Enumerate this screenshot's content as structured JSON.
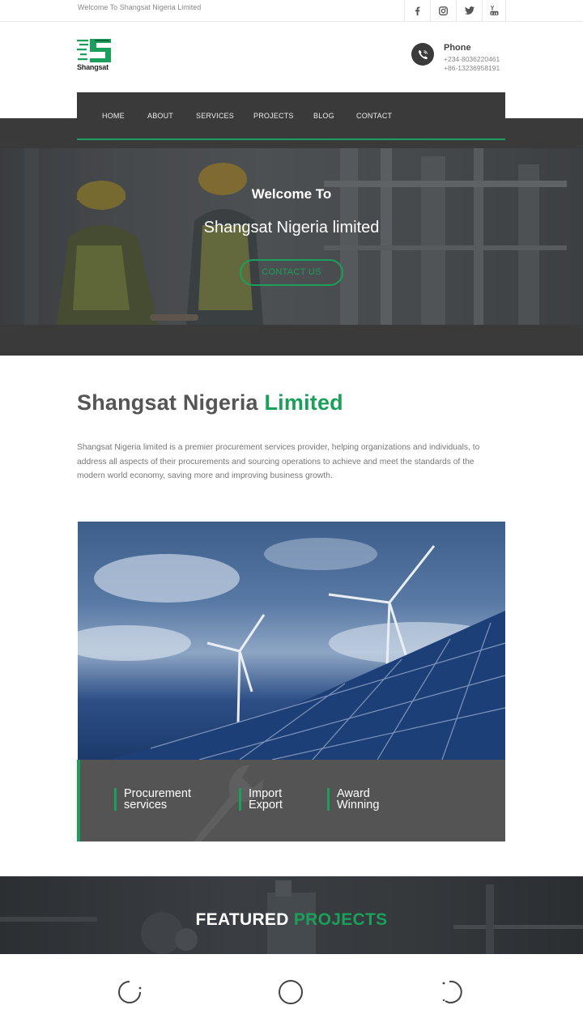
{
  "topbar": {
    "welcome": "Welcome To Shangsat Nigeria Limited",
    "socials": [
      "facebook-icon",
      "instagram-icon",
      "twitter-icon",
      "youtube-icon"
    ]
  },
  "brand": {
    "logo_text": "Shangsat",
    "accent": "#1aa05a"
  },
  "contact": {
    "label": "Phone",
    "numbers": [
      "+234-8036220461",
      "+86-13236958191"
    ]
  },
  "nav": {
    "items": [
      "HOME",
      "ABOUT",
      "SERVICES",
      "PROJECTS",
      "BLOG",
      "CONTACT"
    ]
  },
  "hero": {
    "welcome": "Welcome To",
    "title": "Shangsat Nigeria limited",
    "button": "CONTACT US"
  },
  "about": {
    "title_main": "Shangsat Nigeria",
    "title_accent": "Limited",
    "text": "Shangsat Nigeria limited is a premier procurement services provider, helping organizations and individuals, to address all aspects of their procurements and sourcing operations to achieve and meet the standards of the modern world economy, saving more and improving business growth."
  },
  "stats": [
    {
      "line1": "Procurement",
      "line2": "services"
    },
    {
      "line1": "Import",
      "line2": "Export"
    },
    {
      "line1": "Award",
      "line2": "Winning"
    }
  ],
  "featured": {
    "title_main": "FEATURED",
    "title_accent": "PROJECTS"
  }
}
